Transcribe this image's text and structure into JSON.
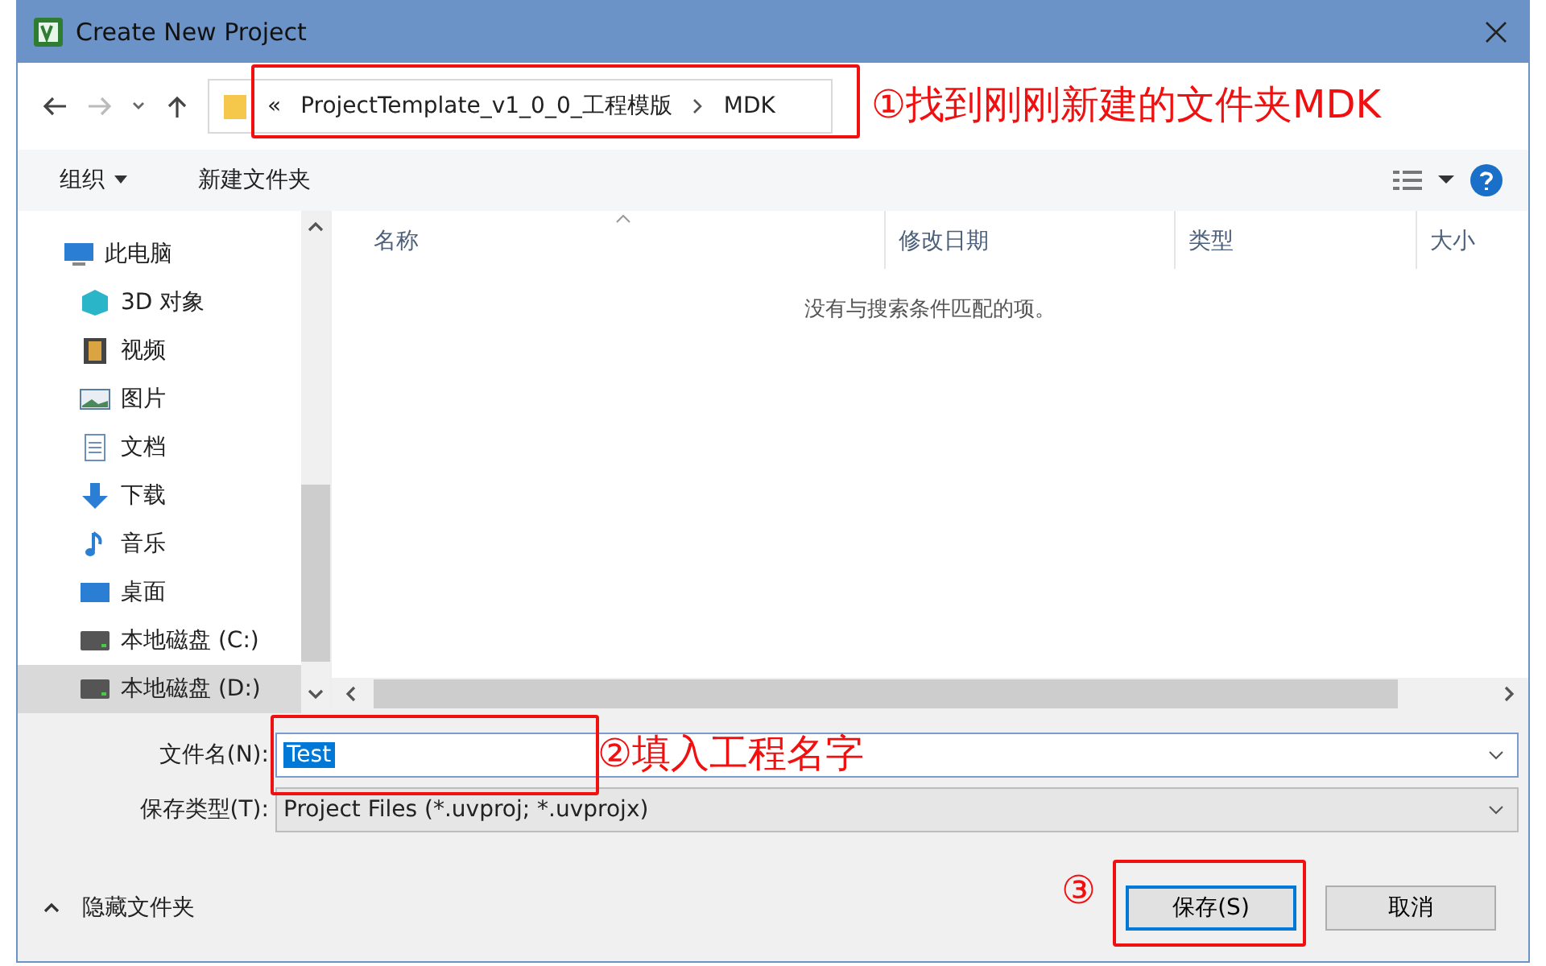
{
  "window": {
    "title": "Create New Project"
  },
  "address": {
    "overflow": "«",
    "crumbs": [
      "ProjectTemplate_v1_0_0_工程模版",
      "MDK"
    ]
  },
  "toolbar": {
    "organize": "组织",
    "new_folder": "新建文件夹"
  },
  "sidebar": {
    "items": [
      {
        "label": "此电脑",
        "kind": "pc",
        "selected": false,
        "children": [
          {
            "label": "3D 对象",
            "kind": "cube",
            "selected": false
          },
          {
            "label": "视频",
            "kind": "film",
            "selected": false
          },
          {
            "label": "图片",
            "kind": "picture",
            "selected": false
          },
          {
            "label": "文档",
            "kind": "doc",
            "selected": false
          },
          {
            "label": "下载",
            "kind": "download",
            "selected": false
          },
          {
            "label": "音乐",
            "kind": "music",
            "selected": false
          },
          {
            "label": "桌面",
            "kind": "desktop",
            "selected": false
          },
          {
            "label": "本地磁盘 (C:)",
            "kind": "drive",
            "selected": false
          },
          {
            "label": "本地磁盘 (D:)",
            "kind": "drive",
            "selected": true
          }
        ]
      }
    ]
  },
  "table": {
    "columns": [
      "名称",
      "修改日期",
      "类型",
      "大小"
    ],
    "empty_message": "没有与搜索条件匹配的项。"
  },
  "form": {
    "filename_label": "文件名(N):",
    "filename_value": "Test",
    "filetype_label": "保存类型(T):",
    "filetype_value": "Project Files (*.uvproj; *.uvprojx)"
  },
  "footer": {
    "hide_folders": "隐藏文件夹",
    "buttons": [
      {
        "label": "保存(S)",
        "selected": true
      },
      {
        "label": "取消",
        "selected": false
      }
    ]
  },
  "annotations": [
    {
      "text": "①找到刚刚新建的文件夹MDK"
    },
    {
      "text": "②填入工程名字"
    },
    {
      "text": "③"
    }
  ]
}
